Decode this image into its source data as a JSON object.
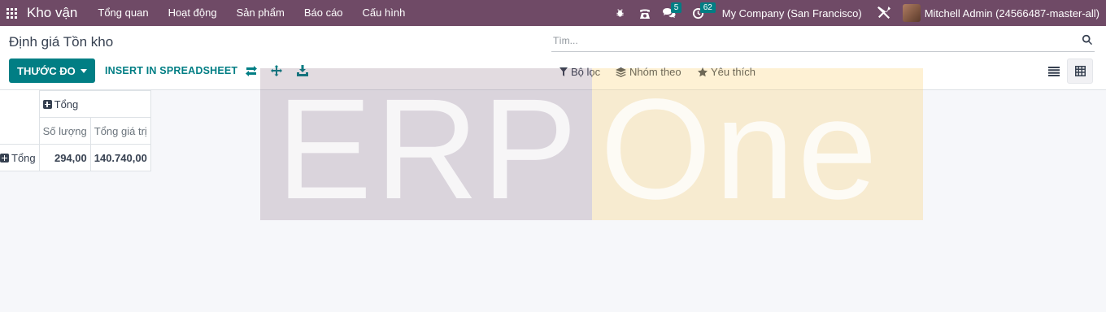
{
  "navbar": {
    "brand": "Kho vận",
    "menu": [
      "Tổng quan",
      "Hoạt động",
      "Sản phẩm",
      "Báo cáo",
      "Cấu hình"
    ],
    "messages_count": "5",
    "activities_count": "62",
    "company": "My Company (San Francisco)",
    "user": "Mitchell Admin (24566487-master-all)"
  },
  "control_panel": {
    "title": "Định giá Tồn kho",
    "search_placeholder": "Tìm...",
    "measures_label": "THƯỚC ĐO",
    "spreadsheet_label": "INSERT IN SPREADSHEET",
    "filters_label": "Bộ lọc",
    "groupby_label": "Nhóm theo",
    "favorites_label": "Yêu thích"
  },
  "pivot": {
    "col_header": "Tổng",
    "measures": [
      "Số lượng",
      "Tổng giá trị"
    ],
    "row_header": "Tổng",
    "values": [
      "294,00",
      "140.740,00"
    ]
  },
  "watermark": {
    "part1": "ERP",
    "part2": "One"
  },
  "colors": {
    "navbar": "#6f4a66",
    "primary": "#017e84"
  }
}
